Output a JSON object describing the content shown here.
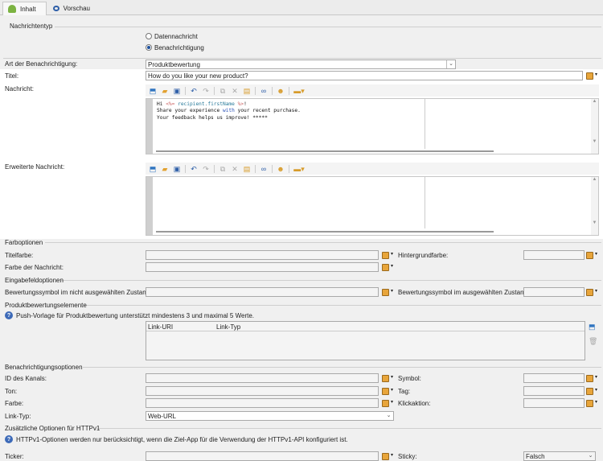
{
  "tabs": {
    "content": "Inhalt",
    "preview": "Vorschau"
  },
  "msg_type": {
    "title": "Nachrichtentyp",
    "data": "Datennachricht",
    "notification": "Benachrichtigung"
  },
  "notif_kind": {
    "label": "Art der Benachrichtigung:",
    "value": "Produktbewertung"
  },
  "title": {
    "label": "Titel:",
    "value": "How do you like your new product?"
  },
  "message": {
    "label": "Nachricht:",
    "line1_pre": "Hi ",
    "tag_open": "<%= ",
    "tag_var": "recipient.firstName",
    "tag_close": " %>",
    "line1_post": "!",
    "line2_a": "Share your experience ",
    "line2_kw": "with",
    "line2_b": " your recent purchase.",
    "line3": "Your feedback helps us improve! *****"
  },
  "extended": {
    "label": "Erweiterte Nachricht:"
  },
  "colors": {
    "title": "Farboptionen",
    "title_color": "Titelfarbe:",
    "bg_color": "Hintergrundfarbe:",
    "msg_color": "Farbe der Nachricht:"
  },
  "input": {
    "title": "Eingabefeldoptionen",
    "unselected": "Bewertungssymbol im nicht ausgewählten Zustand:",
    "selected": "Bewertungssymbol im ausgewählten Zustand :"
  },
  "rating": {
    "title": "Produktbewertungselemente",
    "info": "Push-Vorlage für Produktbewertung unterstützt mindestens 3 und maximal 5 Werte.",
    "col_uri": "Link-URI",
    "col_type": "Link-Typ"
  },
  "notif_opts": {
    "title": "Benachrichtigungsoptionen",
    "channel": "ID des Kanals:",
    "symbol": "Symbol:",
    "sound": "Ton:",
    "tag": "Tag:",
    "color": "Farbe:",
    "click": "Klickaktion:",
    "link_type": "Link-Typ:",
    "link_type_value": "Web-URL"
  },
  "httpv1": {
    "title": "Zusätzliche Optionen für HTTPv1",
    "info": "HTTPv1-Optionen werden nur berücksichtigt, wenn die Ziel-App für die Verwendung der HTTPv1-API konfiguriert ist.",
    "ticker": "Ticker:",
    "sticky": "Sticky:",
    "sticky_value": "Falsch"
  },
  "accent": "#e8a53a"
}
